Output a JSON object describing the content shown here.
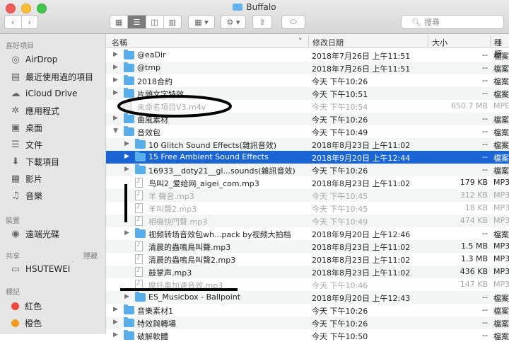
{
  "window": {
    "title": "Buffalo"
  },
  "toolbar": {
    "search_placeholder": "搜尋",
    "view_icons": [
      "icon-view-icon",
      "list-view-icon",
      "column-view-icon",
      "cover-flow-icon"
    ]
  },
  "colors": {
    "selection": "#1a65d6",
    "folder": "#58aeea",
    "red_tag": "#f0473f",
    "orange_tag": "#f49a1d"
  },
  "sidebar": {
    "favorites_header": "喜好項目",
    "favorites": [
      {
        "label": "AirDrop",
        "icon": "airdrop-icon"
      },
      {
        "label": "最近使用過的項目",
        "icon": "recents-icon"
      },
      {
        "label": "iCloud Drive",
        "icon": "cloud-icon"
      },
      {
        "label": "應用程式",
        "icon": "applications-icon"
      },
      {
        "label": "桌面",
        "icon": "desktop-icon"
      },
      {
        "label": "文件",
        "icon": "documents-icon"
      },
      {
        "label": "下載項目",
        "icon": "downloads-icon"
      },
      {
        "label": "影片",
        "icon": "movies-icon"
      },
      {
        "label": "音樂",
        "icon": "music-icon"
      }
    ],
    "devices_header": "裝置",
    "devices": [
      {
        "label": "遠端光碟",
        "icon": "disc-icon"
      }
    ],
    "shared_header": "共享",
    "shared_hide": "隱藏",
    "shared": [
      {
        "label": "HSUTEWEI",
        "icon": "computer-icon"
      }
    ],
    "tags_header": "標記",
    "tags": [
      {
        "label": "紅色",
        "color": "#f0473f"
      },
      {
        "label": "橙色",
        "color": "#f49a1d"
      }
    ]
  },
  "columns": {
    "name": "名稱",
    "date": "修改日期",
    "size": "大小",
    "kind": "種類"
  },
  "rows": [
    {
      "name": "@eaDir",
      "date": "2018年7月26日 上午11:51",
      "size": "--",
      "kind": "檔案",
      "type": "folder",
      "level": 0,
      "expander": "closed"
    },
    {
      "name": "@tmp",
      "date": "2018年7月26日 上午11:51",
      "size": "--",
      "kind": "檔案",
      "type": "folder",
      "level": 0,
      "expander": "closed"
    },
    {
      "name": "2018合約",
      "date": "今天 下午10:26",
      "size": "--",
      "kind": "檔案",
      "type": "folder",
      "level": 0,
      "expander": "closed"
    },
    {
      "name": "片頭文字特效",
      "date": "今天 下午10:51",
      "size": "--",
      "kind": "檔案",
      "type": "folder",
      "level": 0,
      "expander": "closed"
    },
    {
      "name": "未命名項目V3.m4v",
      "date": "今天 下午10:54",
      "size": "650.7 MB",
      "kind": "MPE",
      "type": "movie",
      "level": 0,
      "expander": "none",
      "dim": true
    },
    {
      "name": "曲風素材",
      "date": "今天 下午10:26",
      "size": "--",
      "kind": "檔案",
      "type": "folder",
      "level": 0,
      "expander": "closed"
    },
    {
      "name": "音效包",
      "date": "今天 下午10:49",
      "size": "--",
      "kind": "檔案",
      "type": "folder",
      "level": 0,
      "expander": "open"
    },
    {
      "name": "10 Glitch Sound Effects(雜訊音效)",
      "date": "2018年8月23日 上午11:02",
      "size": "--",
      "kind": "檔案",
      "type": "folder",
      "level": 1,
      "expander": "closed"
    },
    {
      "name": "15 Free Ambient Sound Effects",
      "date": "2018年9月20日 上午12:44",
      "size": "--",
      "kind": "檔案",
      "type": "folder",
      "level": 1,
      "expander": "closed",
      "selected": true
    },
    {
      "name": "16933__doty21__gl...sounds(雜訊音效)",
      "date": "今天 下午10:26",
      "size": "--",
      "kind": "檔案",
      "type": "folder",
      "level": 1,
      "expander": "closed"
    },
    {
      "name": "鸟叫2_爱给网_aigei_com.mp3",
      "date": "2018年8月23日 上午11:02",
      "size": "179 KB",
      "kind": "MP3",
      "type": "doc",
      "level": 1,
      "expander": "none"
    },
    {
      "name": "羊 聲音.mp3",
      "date": "今天 下午10:45",
      "size": "312 KB",
      "kind": "MP3",
      "type": "doc",
      "level": 1,
      "expander": "none",
      "dim": true
    },
    {
      "name": "羊叫聲2.mp3",
      "date": "今天 下午10:45",
      "size": "18 KB",
      "kind": "MP3",
      "type": "doc",
      "level": 1,
      "expander": "none",
      "dim": true
    },
    {
      "name": "相機快門聲.mp3",
      "date": "今天 下午10:49",
      "size": "474 KB",
      "kind": "MP3",
      "type": "doc",
      "level": 1,
      "expander": "none",
      "dim": true
    },
    {
      "name": "视频转场音效包wh...pack by视频大拍档",
      "date": "2018年9月20日 上午12:46",
      "size": "--",
      "kind": "檔案",
      "type": "folder",
      "level": 1,
      "expander": "closed"
    },
    {
      "name": "清晨的蟲鳴鳥叫聲.mp3",
      "date": "2018年8月23日 上午11:02",
      "size": "1.5 MB",
      "kind": "MP3",
      "type": "doc",
      "level": 1,
      "expander": "none"
    },
    {
      "name": "清晨的蟲鳴鳥叫聲2.mp3",
      "date": "2018年8月23日 上午11:02",
      "size": "1.3 MB",
      "kind": "MP3",
      "type": "doc",
      "level": 1,
      "expander": "none"
    },
    {
      "name": "鼓掌声.mp3",
      "date": "2018年8月23日 上午11:02",
      "size": "436 KB",
      "kind": "MP3",
      "type": "doc",
      "level": 1,
      "expander": "none"
    },
    {
      "name": "摩托車加速音效.mp3",
      "date": "今天 下午10:46",
      "size": "147 KB",
      "kind": "MP3",
      "type": "doc",
      "level": 1,
      "expander": "none",
      "dim": true
    },
    {
      "name": "ES_Musicbox - Ballpoint",
      "date": "2018年9月20日 上午12:43",
      "size": "--",
      "kind": "檔案",
      "type": "folder",
      "level": 1,
      "expander": "closed"
    },
    {
      "name": "音樂素材1",
      "date": "今天 下午10:26",
      "size": "--",
      "kind": "檔案",
      "type": "folder",
      "level": 0,
      "expander": "closed"
    },
    {
      "name": "特效與轉場",
      "date": "今天 下午10:26",
      "size": "--",
      "kind": "檔案",
      "type": "folder",
      "level": 0,
      "expander": "closed"
    },
    {
      "name": "破解軟體",
      "date": "今天 下午10:50",
      "size": "--",
      "kind": "檔案",
      "type": "folder",
      "level": 0,
      "expander": "closed"
    }
  ]
}
